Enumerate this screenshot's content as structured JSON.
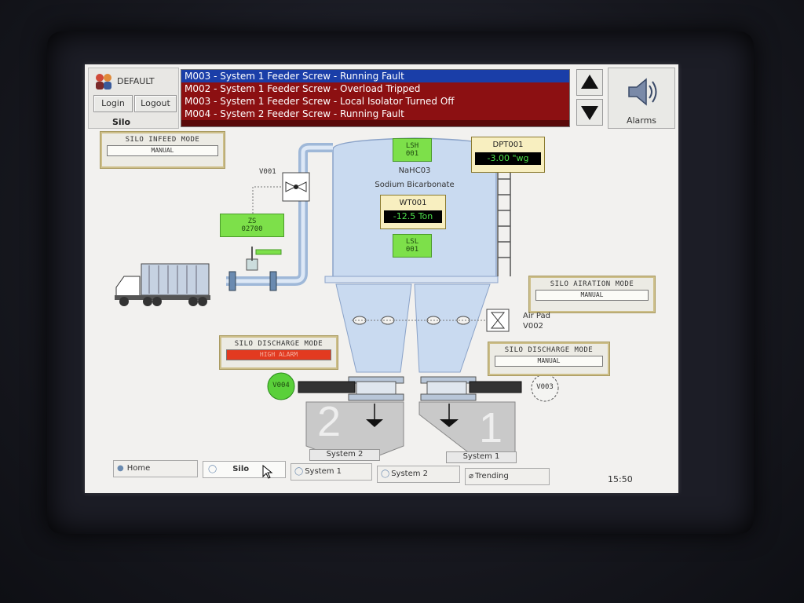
{
  "user": {
    "name": "DEFAULT",
    "login_label": "Login",
    "logout_label": "Logout",
    "screen_label": "Silo"
  },
  "alarms": [
    "M003 - System 1 Feeder Screw - Running Fault",
    "M002 - System 1 Feeder Screw - Overload Tripped",
    "M003 - System 1 Feeder Screw - Local Isolator Turned Off",
    "M004 - System 2 Feeder Screw - Running Fault"
  ],
  "alarms_button_label": "Alarms",
  "modes": {
    "infeed": {
      "title": "SILO INFEED MODE",
      "value": "MANUAL"
    },
    "airation": {
      "title": "SILO AIRATION MODE",
      "value": "MANUAL"
    },
    "discharge_left": {
      "title": "SILO DISCHARGE MODE",
      "value": "HIGH ALARM"
    },
    "discharge_right": {
      "title": "SILO DISCHARGE MODE",
      "value": "MANUAL"
    }
  },
  "silo": {
    "product_formula": "NaHC03",
    "product_name": "Sodium Bicarbonate"
  },
  "indicators": {
    "lsh": "LSH\n001",
    "lsl": "LSL\n001",
    "zs": "ZS\n02700"
  },
  "wt001": {
    "tag": "WT001",
    "value": "-12.5 Ton"
  },
  "dpt001": {
    "tag": "DPT001",
    "value": "-3.00 \"wg"
  },
  "valves": {
    "v001": "V001",
    "v002": "Air Pad\nV002",
    "v003": "V003",
    "v004": "V004"
  },
  "systems": {
    "two_number": "2",
    "two_label": "System 2",
    "one_number": "1",
    "one_label": "System 1"
  },
  "taskbar": {
    "home": "Home",
    "silo": "Silo",
    "system1": "System 1",
    "system2": "System 2",
    "trending": "Trending",
    "clock": "15:50"
  },
  "colors": {
    "alarm_selected": "#1a3ea8",
    "alarm_row": "#8c1012",
    "indicator_green": "#7de04a",
    "high_alarm_red": "#e23a20"
  }
}
